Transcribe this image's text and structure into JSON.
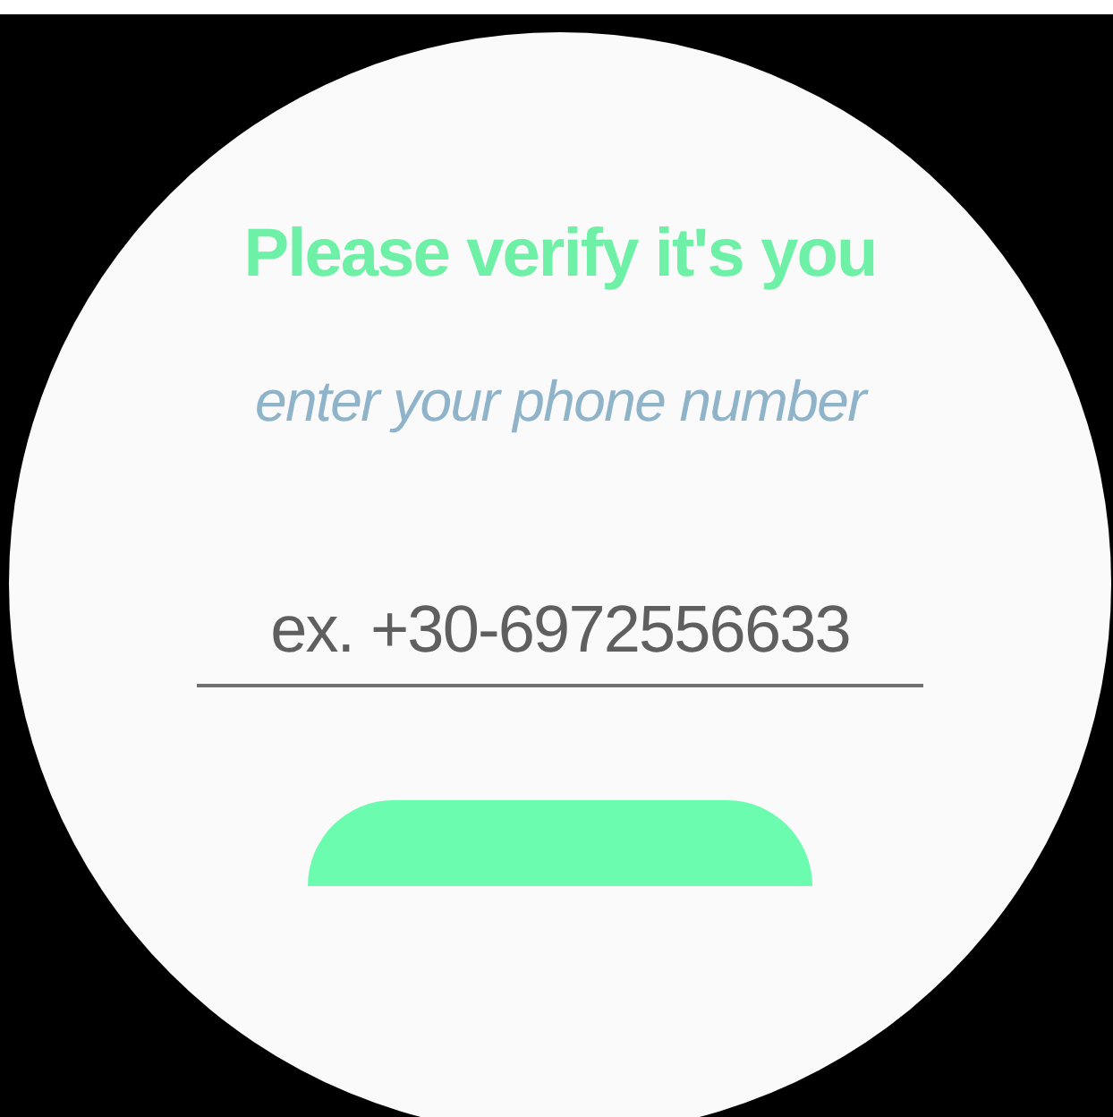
{
  "title": "Please verify it's you",
  "subtitle": "enter your phone number",
  "phone_field": {
    "placeholder": "ex. +30-6972556633"
  }
}
